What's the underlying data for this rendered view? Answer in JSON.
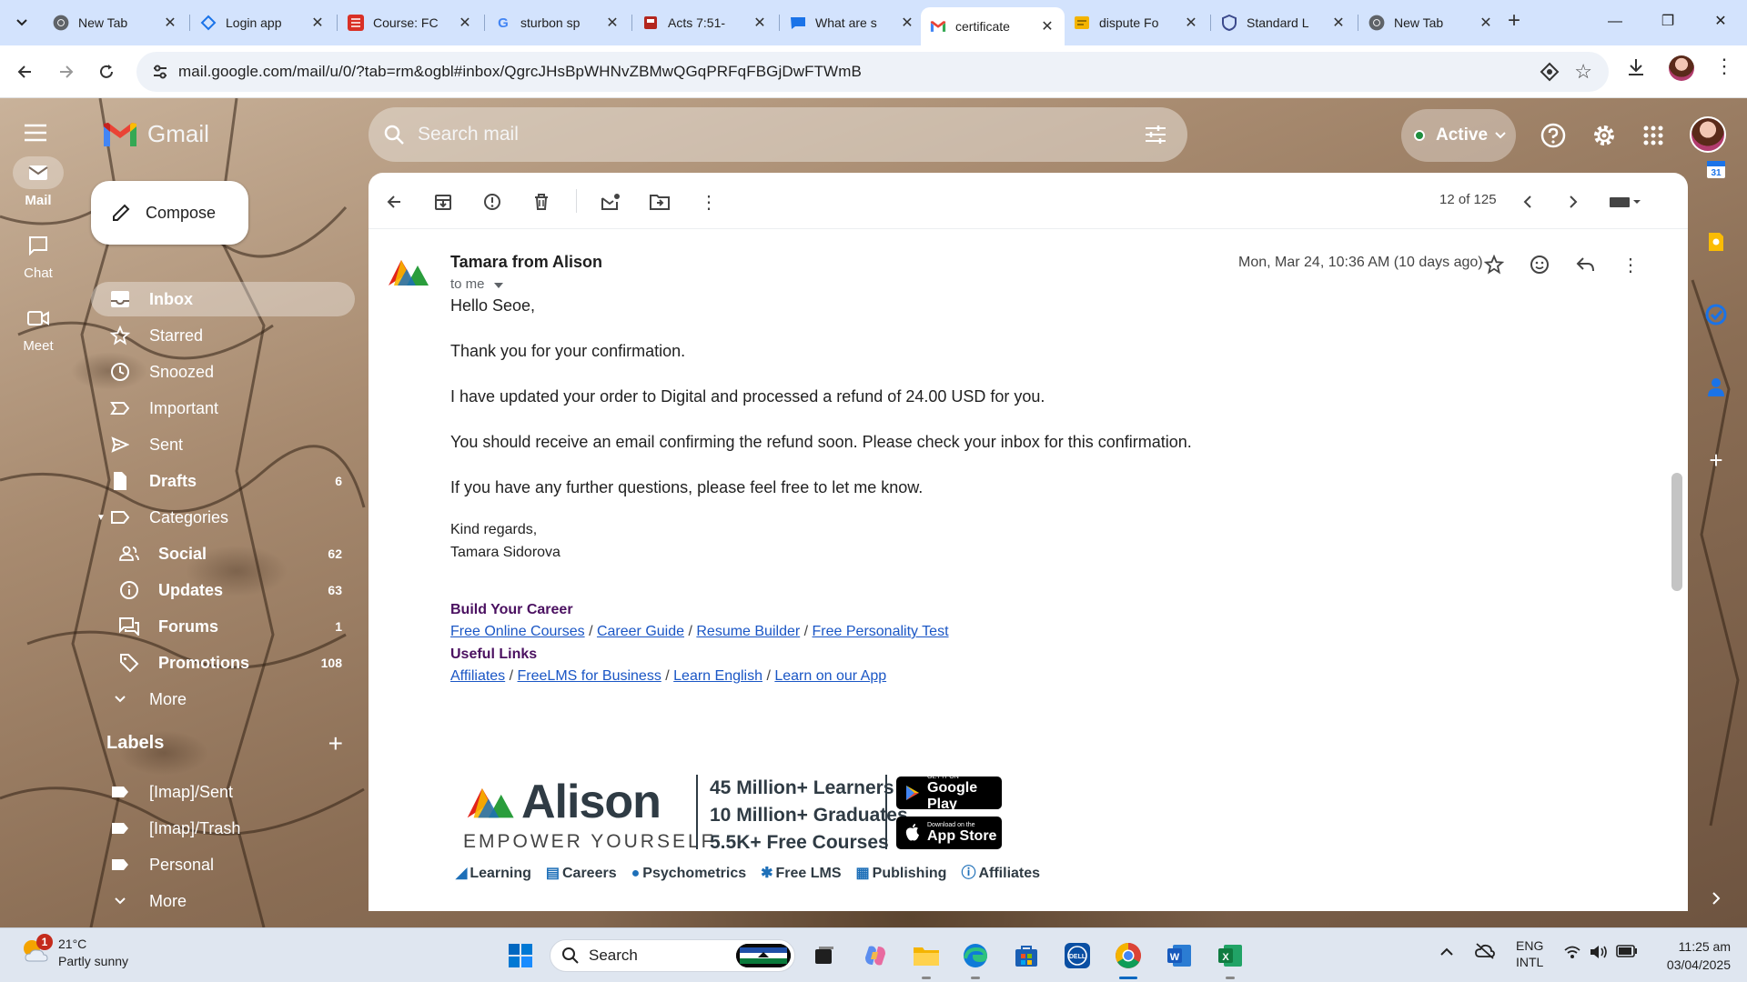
{
  "browser": {
    "tabs": [
      {
        "title": "New Tab",
        "favicon": "chrome-icon",
        "color": "#5f6368"
      },
      {
        "title": "Login app",
        "favicon": "layers-icon",
        "color": "#1a73e8"
      },
      {
        "title": "Course: FC",
        "favicon": "grid-icon",
        "color": "#d93025"
      },
      {
        "title": "sturbon sp",
        "favicon": "google-icon",
        "color": "#4285f4"
      },
      {
        "title": "Acts 7:51-",
        "favicon": "bible-icon",
        "color": "#b3261e"
      },
      {
        "title": "What are s",
        "favicon": "chat-icon",
        "color": "#1a73e8"
      },
      {
        "title": "certificate",
        "favicon": "gmail-icon",
        "color": "#ea4335"
      },
      {
        "title": "dispute Fo",
        "favicon": "note-icon",
        "color": "#f4b400"
      },
      {
        "title": "Standard L",
        "favicon": "shield-icon",
        "color": "#3c4a8c"
      },
      {
        "title": "New Tab",
        "favicon": "chrome-icon",
        "color": "#5f6368"
      }
    ],
    "active_tab_index": 6,
    "url": "mail.google.com/mail/u/0/?tab=rm&ogbl#inbox/QgrcJHsBpWHNvZBMwQGqPRFqFBGjDwFTWmB"
  },
  "gmail": {
    "app_name": "Gmail",
    "search_placeholder": "Search mail",
    "status": "Active",
    "rail": {
      "mail": "Mail",
      "chat": "Chat",
      "meet": "Meet"
    },
    "compose": "Compose",
    "nav": [
      {
        "label": "Inbox",
        "count": "",
        "icon": "inbox-icon"
      },
      {
        "label": "Starred",
        "count": "",
        "icon": "star-icon"
      },
      {
        "label": "Snoozed",
        "count": "",
        "icon": "clock-icon"
      },
      {
        "label": "Important",
        "count": "",
        "icon": "important-icon"
      },
      {
        "label": "Sent",
        "count": "",
        "icon": "send-icon"
      },
      {
        "label": "Drafts",
        "count": "6",
        "icon": "draft-icon"
      },
      {
        "label": "Categories",
        "count": "",
        "icon": "label-icon"
      },
      {
        "label": "Social",
        "count": "62",
        "icon": "people-icon"
      },
      {
        "label": "Updates",
        "count": "63",
        "icon": "info-icon"
      },
      {
        "label": "Forums",
        "count": "1",
        "icon": "forum-icon"
      },
      {
        "label": "Promotions",
        "count": "108",
        "icon": "tag-icon"
      },
      {
        "label": "More",
        "count": "",
        "icon": "chevron-down-icon"
      }
    ],
    "labels_title": "Labels",
    "labels": [
      "[Imap]/Sent",
      "[Imap]/Trash",
      "Personal",
      "More"
    ],
    "pager": "12 of 125"
  },
  "email": {
    "sender": "Tamara from Alison",
    "to": "to me",
    "date": "Mon, Mar 24, 10:36 AM (10 days ago)",
    "greeting": "Hello Seoe,",
    "p1": "Thank you for your confirmation.",
    "p2": "I have updated your order to Digital and processed a refund of 24.00 USD for you.",
    "p3": "You should receive an email confirming the refund soon. Please check your inbox for this confirmation.",
    "p4": "If you have any further questions, please feel free to let me know.",
    "signoff": "Kind regards,",
    "signature": "Tamara Sidorova",
    "footer": {
      "career_heading": "Build Your Career",
      "career_links": [
        "Free Online Courses",
        "Career Guide",
        "Resume Builder",
        "Free Personality Test"
      ],
      "useful_heading": "Useful Links",
      "useful_links": [
        "Affiliates",
        "FreeLMS for Business",
        "Learn English",
        " Learn on our App"
      ],
      "banner_brand": "Alison",
      "banner_tagline": "EMPOWER YOURSELF",
      "banner_stats": [
        "45 Million+ Learners",
        "10 Million+ Graduates",
        "5.5K+ Free Courses"
      ],
      "google_play_small": "GET IT ON",
      "google_play": "Google Play",
      "app_store_small": "Download on the",
      "app_store": "App Store",
      "banner_items": [
        "Learning",
        "Careers",
        "Psychometrics",
        "Free LMS",
        "Publishing",
        "Affiliates"
      ]
    }
  },
  "taskbar": {
    "weather_badge": "1",
    "temperature": "21°C",
    "condition": "Partly sunny",
    "search": "Search",
    "lang": "ENG",
    "layout": "INTL",
    "time": "11:25 am",
    "date": "03/04/2025"
  }
}
